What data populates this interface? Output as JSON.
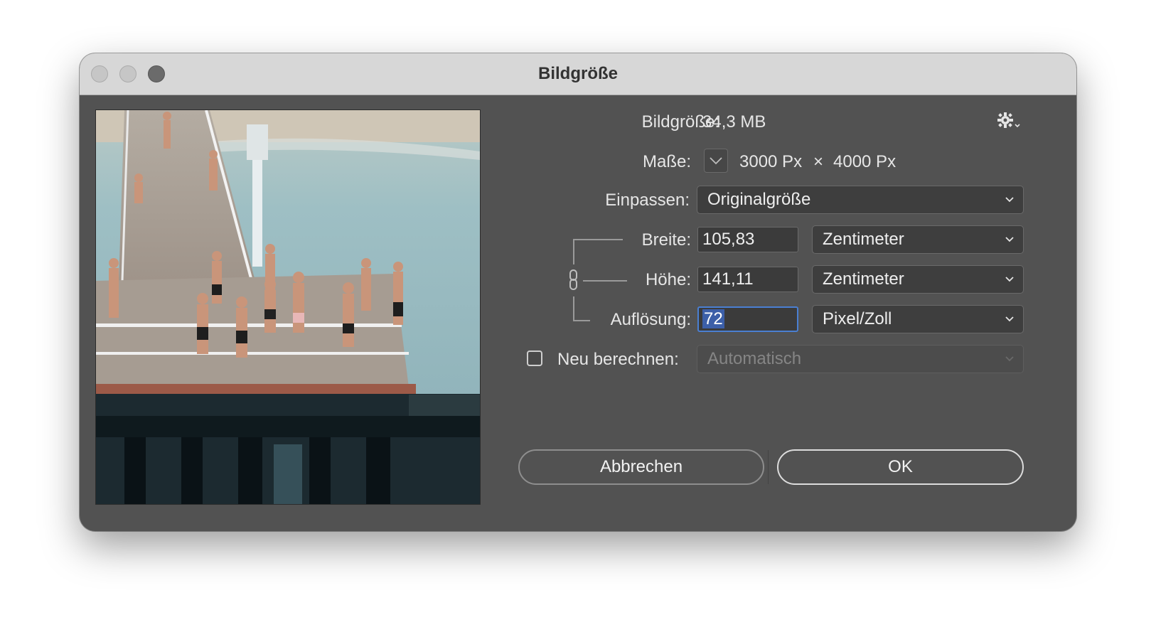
{
  "window": {
    "title": "Bildgröße"
  },
  "image_size": {
    "label": "Bildgröße:",
    "value": "34,3 MB"
  },
  "dimensions": {
    "label": "Maße:",
    "width": "3000 Px",
    "times": "×",
    "height": "4000 Px"
  },
  "fit": {
    "label": "Einpassen:",
    "selected": "Originalgröße"
  },
  "width": {
    "label": "Breite:",
    "value": "105,83",
    "unit": "Zentimeter"
  },
  "height": {
    "label": "Höhe:",
    "value": "141,11",
    "unit": "Zentimeter"
  },
  "resolution": {
    "label": "Auflösung:",
    "value": "72",
    "unit": "Pixel/Zoll"
  },
  "resample": {
    "label": "Neu berechnen:",
    "checked": false,
    "method": "Automatisch"
  },
  "buttons": {
    "cancel": "Abbrechen",
    "ok": "OK"
  },
  "icons": {
    "settings": "gear-icon",
    "link": "chain-link-icon",
    "dimensions_toggle": "chevron-down-icon"
  },
  "colors": {
    "focus": "#4a7fd2",
    "window_bg": "#525252",
    "titlebar": "#d7d7d7"
  }
}
